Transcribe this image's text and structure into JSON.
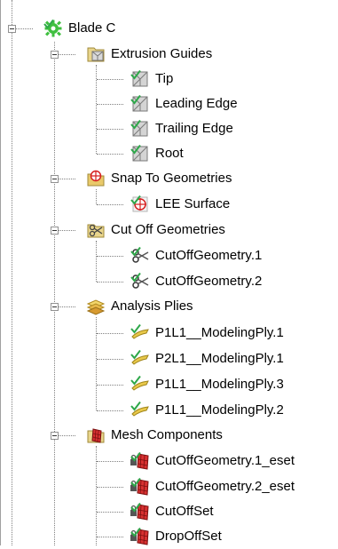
{
  "tree": {
    "root": {
      "label": "Blade C",
      "icon": "gear-icon"
    },
    "groups": [
      {
        "label": "Extrusion Guides",
        "icon": "extrusion-guides-icon",
        "children": [
          {
            "label": "Tip",
            "icon": "guide-icon"
          },
          {
            "label": "Leading Edge",
            "icon": "guide-icon"
          },
          {
            "label": "Trailing Edge",
            "icon": "guide-icon"
          },
          {
            "label": "Root",
            "icon": "guide-icon"
          }
        ]
      },
      {
        "label": "Snap To Geometries",
        "icon": "snap-geometries-icon",
        "children": [
          {
            "label": "LEE Surface",
            "icon": "snap-target-icon"
          }
        ]
      },
      {
        "label": "Cut Off Geometries",
        "icon": "cut-off-folder-icon",
        "children": [
          {
            "label": "CutOffGeometry.1",
            "icon": "scissors-icon"
          },
          {
            "label": "CutOffGeometry.2",
            "icon": "scissors-icon"
          }
        ]
      },
      {
        "label": "Analysis Plies",
        "icon": "analysis-plies-icon",
        "children": [
          {
            "label": "P1L1__ModelingPly.1",
            "icon": "ply-icon"
          },
          {
            "label": "P2L1__ModelingPly.1",
            "icon": "ply-icon"
          },
          {
            "label": "P1L1__ModelingPly.3",
            "icon": "ply-icon"
          },
          {
            "label": "P1L1__ModelingPly.2",
            "icon": "ply-icon"
          }
        ]
      },
      {
        "label": "Mesh Components",
        "icon": "mesh-components-icon",
        "children": [
          {
            "label": "CutOffGeometry.1_eset",
            "icon": "locked-element-set-icon"
          },
          {
            "label": "CutOffGeometry.2_eset",
            "icon": "locked-element-set-icon"
          },
          {
            "label": "CutOffSet",
            "icon": "locked-element-set-icon"
          },
          {
            "label": "DropOffSet",
            "icon": "locked-element-set-icon"
          }
        ]
      }
    ]
  },
  "colors": {
    "check": "#2ea84a",
    "connector": "#808080",
    "gear": "#3fbf3f"
  }
}
